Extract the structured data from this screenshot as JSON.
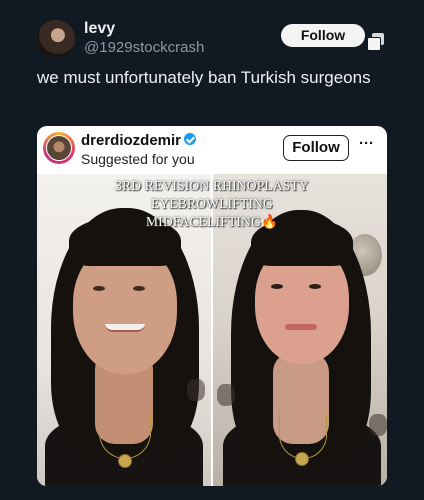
{
  "post": {
    "author_name": "levy",
    "author_handle": "@1929stockcrash",
    "follow_label": "Follow",
    "text": "we must unfortunately ban Turkish surgeons"
  },
  "embedded_card": {
    "username": "drerdiozdemir",
    "subtitle": "Suggested for you",
    "follow_label": "Follow",
    "more_label": "···",
    "overlay_lines": [
      "3RD REVISION RHINOPLASTY",
      "EYEBROWLIFTING",
      "MIDFACELIFTING"
    ],
    "overlay_emoji": "🔥"
  },
  "colors": {
    "background": "#111a23",
    "handle": "#8b98a5",
    "verified": "#1d9bf0"
  },
  "icons": [
    "copy-icon",
    "verified-icon"
  ]
}
